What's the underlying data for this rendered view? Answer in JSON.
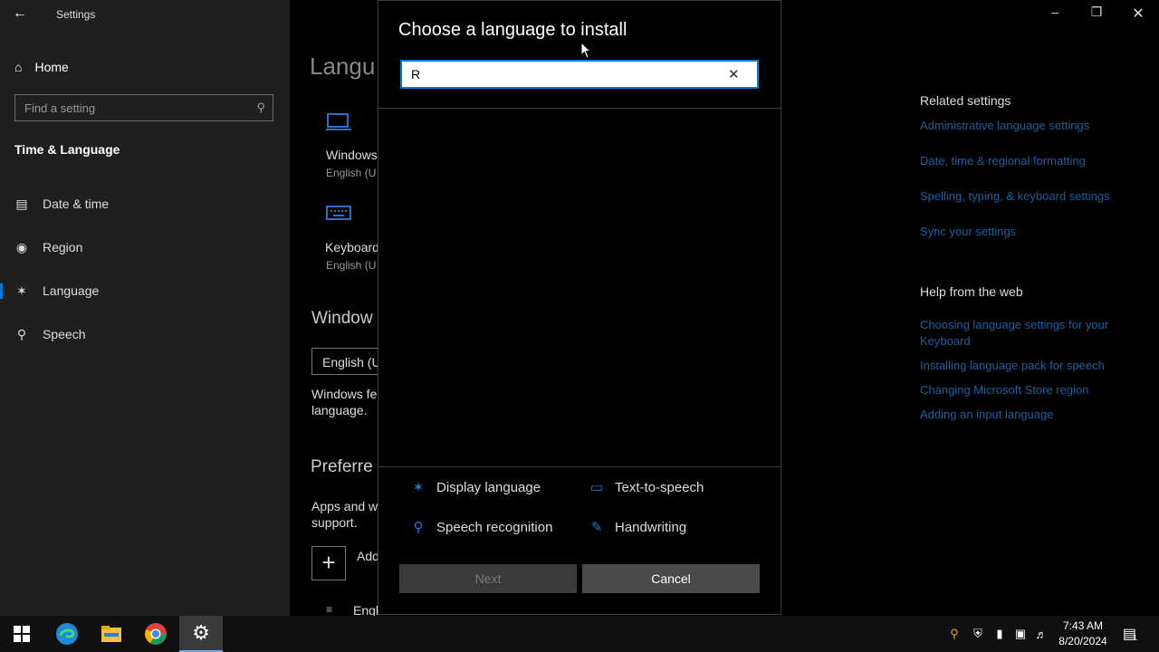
{
  "window": {
    "title": "Settings",
    "controls": [
      "minimize-icon",
      "restore-icon",
      "close-icon"
    ]
  },
  "sidebar": {
    "home_label": "Home",
    "search_placeholder": "Find a setting",
    "section_title": "Time & Language",
    "items": [
      {
        "label": "Date & time",
        "icon": "calendar-icon"
      },
      {
        "label": "Region",
        "icon": "globe-icon"
      },
      {
        "label": "Language",
        "icon": "language-icon",
        "active": true
      },
      {
        "label": "Speech",
        "icon": "microphone-icon"
      }
    ]
  },
  "main": {
    "title_partial": "Langu",
    "windows_display": {
      "label": "Windows",
      "sub": "English (U"
    },
    "keyboard": {
      "label": "Keyboard",
      "sub": "English (U"
    },
    "windows_display_heading": "Window",
    "display_dropdown": "English (U",
    "windows_features_text_1": "Windows fe",
    "windows_features_text_2": "language.",
    "preferred_heading": "Preferre",
    "apps_text_1": "Apps and w",
    "apps_text_2": "support.",
    "add_label": "Add",
    "english_item": "Engl"
  },
  "related": {
    "heading": "Related settings",
    "links": [
      "Administrative language settings",
      "Date, time & regional formatting",
      "Spelling, typing, & keyboard settings",
      "Sync your settings"
    ]
  },
  "help": {
    "heading": "Help from the web",
    "links": [
      "Choosing language settings for your Keyboard",
      "Installing language pack for speech",
      "Changing Microsoft Store region",
      "Adding an input language"
    ]
  },
  "dialog": {
    "title": "Choose a language to install",
    "search_value": "R",
    "features": [
      {
        "label": "Display language",
        "icon": "display-language-icon"
      },
      {
        "label": "Text-to-speech",
        "icon": "text-to-speech-icon"
      },
      {
        "label": "Speech recognition",
        "icon": "microphone-icon"
      },
      {
        "label": "Handwriting",
        "icon": "handwriting-icon"
      }
    ],
    "next_label": "Next",
    "cancel_label": "Cancel"
  },
  "taskbar": {
    "apps": [
      "start-icon",
      "edge-icon",
      "file-explorer-icon",
      "chrome-icon",
      "settings-icon"
    ],
    "time": "7:43 AM",
    "date": "8/20/2024",
    "notification_count": "1"
  },
  "colors": {
    "accent": "#0078d7",
    "link": "#1a5fa0",
    "sidebar": "#1f1f1f"
  }
}
